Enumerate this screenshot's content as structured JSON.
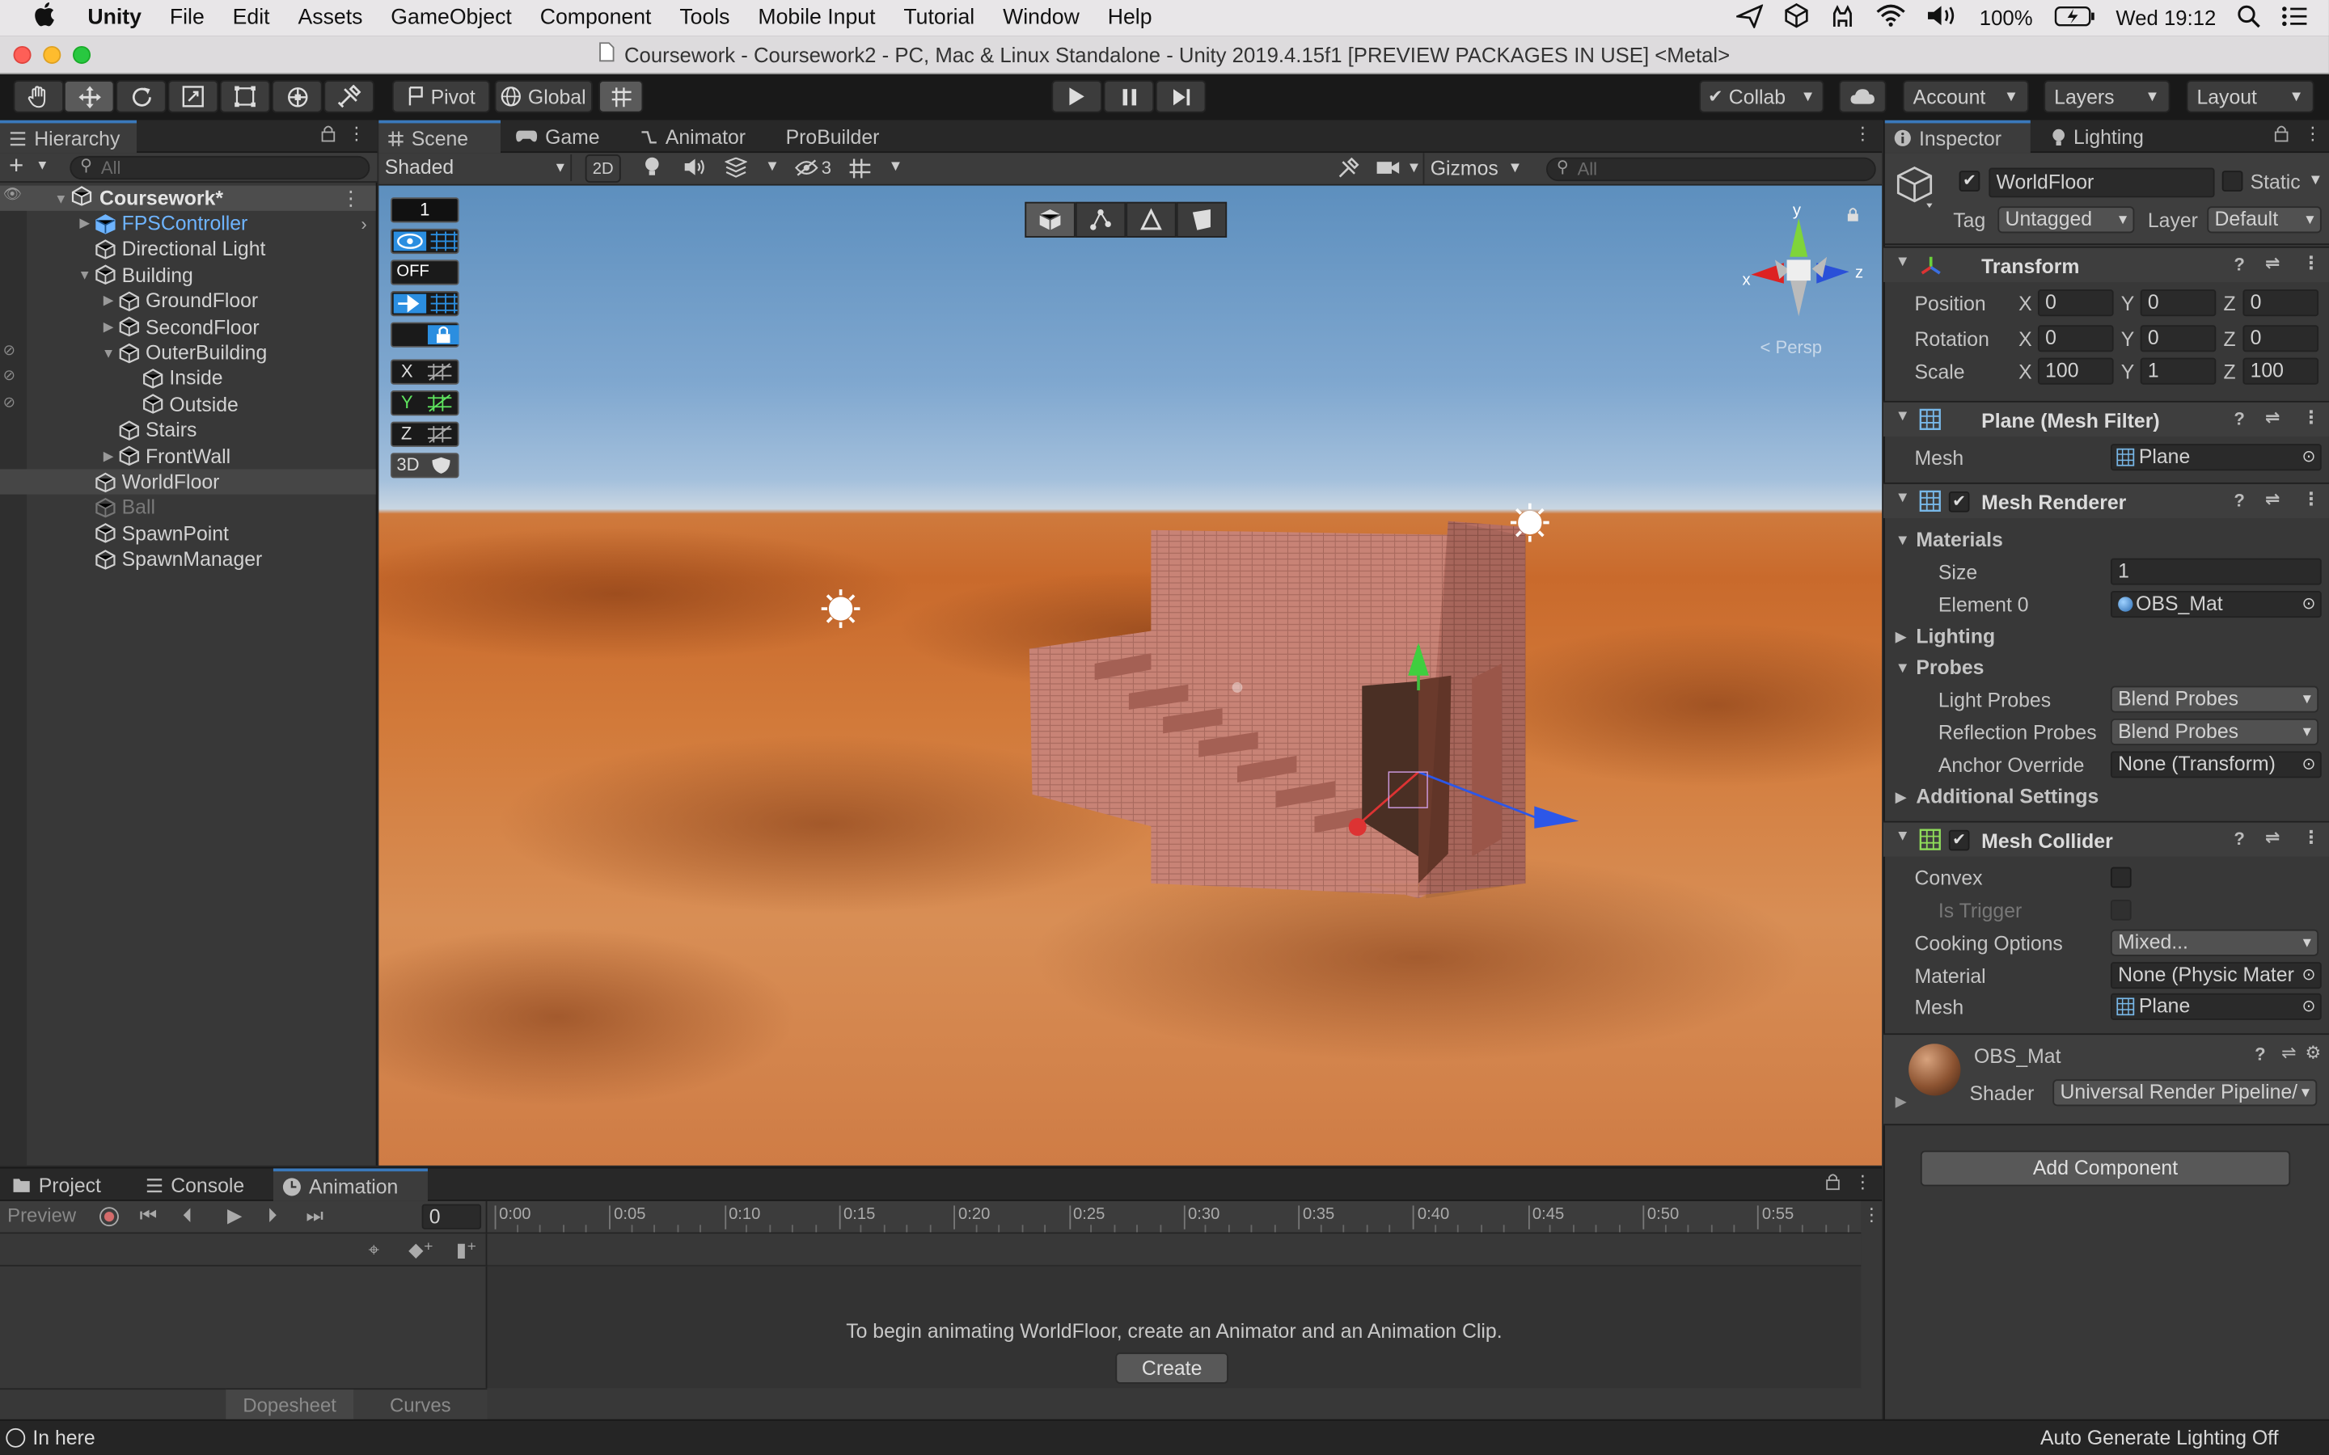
{
  "menubar": {
    "apple": "",
    "app": "Unity",
    "items": [
      "File",
      "Edit",
      "Assets",
      "GameObject",
      "Component",
      "Tools",
      "Mobile Input",
      "Tutorial",
      "Window",
      "Help"
    ],
    "battery": "100%",
    "clock": "Wed 19:12"
  },
  "window": {
    "title": "Coursework - Coursework2 - PC, Mac & Linux Standalone - Unity 2019.4.15f1 [PREVIEW PACKAGES IN USE] <Metal>"
  },
  "toolbar": {
    "pivot": "Pivot",
    "global": "Global",
    "collab": "Collab",
    "account": "Account",
    "layers": "Layers",
    "layout": "Layout"
  },
  "hierarchy": {
    "tab": "Hierarchy",
    "search": "All",
    "scene": "Coursework*",
    "items": [
      {
        "label": "FPSController",
        "depth": 1,
        "arrow": "▶",
        "color": "#6eb4ff"
      },
      {
        "label": "Directional Light",
        "depth": 1,
        "arrow": "",
        "color": "#d2d2d2"
      },
      {
        "label": "Building",
        "depth": 1,
        "arrow": "▼",
        "color": "#d2d2d2"
      },
      {
        "label": "GroundFloor",
        "depth": 2,
        "arrow": "▶",
        "color": "#d2d2d2"
      },
      {
        "label": "SecondFloor",
        "depth": 2,
        "arrow": "▶",
        "color": "#d2d2d2"
      },
      {
        "label": "OuterBuilding",
        "depth": 2,
        "arrow": "▼",
        "color": "#d2d2d2"
      },
      {
        "label": "Inside",
        "depth": 3,
        "arrow": "",
        "color": "#d2d2d2"
      },
      {
        "label": "Outside",
        "depth": 3,
        "arrow": "",
        "color": "#d2d2d2"
      },
      {
        "label": "Stairs",
        "depth": 2,
        "arrow": "",
        "color": "#d2d2d2"
      },
      {
        "label": "FrontWall",
        "depth": 2,
        "arrow": "▶",
        "color": "#d2d2d2"
      },
      {
        "label": "WorldFloor",
        "depth": 1,
        "arrow": "",
        "color": "#d2d2d2"
      },
      {
        "label": "Ball",
        "depth": 1,
        "arrow": "",
        "color": "#7a7a7a"
      },
      {
        "label": "SpawnPoint",
        "depth": 1,
        "arrow": "",
        "color": "#d2d2d2"
      },
      {
        "label": "SpawnManager",
        "depth": 1,
        "arrow": "",
        "color": "#d2d2d2"
      }
    ]
  },
  "scene_tabs": {
    "scene": "Scene",
    "game": "Game",
    "animator": "Animator",
    "probuilder": "ProBuilder"
  },
  "scene_toolbar": {
    "shading": "Shaded",
    "mode2d": "2D",
    "hidden_count": "3",
    "gizmos": "Gizmos",
    "search": "All",
    "persp": "Persp"
  },
  "overlay": {
    "count": "1",
    "off": "OFF",
    "x": "X",
    "y": "Y",
    "z": "Z",
    "d3": "3D"
  },
  "gizmo": {
    "x": "x",
    "y": "y",
    "z": "z"
  },
  "inspector": {
    "tab": "Inspector",
    "lighting_tab": "Lighting",
    "object_name": "WorldFloor",
    "static": "Static",
    "tag_label": "Tag",
    "tag": "Untagged",
    "layer_label": "Layer",
    "layer": "Default",
    "transform": {
      "title": "Transform",
      "position_label": "Position",
      "rotation_label": "Rotation",
      "scale_label": "Scale",
      "x": "X",
      "y": "Y",
      "z": "Z",
      "position": [
        "0",
        "0",
        "0"
      ],
      "rotation": [
        "0",
        "0",
        "0"
      ],
      "scale": [
        "100",
        "1",
        "100"
      ]
    },
    "mesh_filter": {
      "title": "Plane (Mesh Filter)",
      "mesh_label": "Mesh",
      "mesh": "Plane"
    },
    "mesh_renderer": {
      "title": "Mesh Renderer",
      "materials": "Materials",
      "size_label": "Size",
      "size": "1",
      "element0_label": "Element 0",
      "element0": "OBS_Mat",
      "lighting": "Lighting",
      "probes": "Probes",
      "light_probes_label": "Light Probes",
      "light_probes": "Blend Probes",
      "reflection_label": "Reflection Probes",
      "reflection": "Blend Probes",
      "anchor_label": "Anchor Override",
      "anchor": "None (Transform)",
      "additional": "Additional Settings"
    },
    "mesh_collider": {
      "title": "Mesh Collider",
      "convex_label": "Convex",
      "trigger_label": "Is Trigger",
      "cooking_label": "Cooking Options",
      "cooking": "Mixed...",
      "material_label": "Material",
      "material": "None (Physic Mater",
      "mesh_label": "Mesh",
      "mesh": "Plane"
    },
    "material": {
      "name": "OBS_Mat",
      "shader_label": "Shader",
      "shader": "Universal Render Pipeline/"
    },
    "add_component": "Add Component"
  },
  "bottom": {
    "tabs": [
      "Project",
      "Console",
      "Animation"
    ],
    "preview": "Preview",
    "frame": "0",
    "ticks": [
      "0:00",
      "0:05",
      "0:10",
      "0:15",
      "0:20",
      "0:25",
      "0:30",
      "0:35",
      "0:40",
      "0:45",
      "0:50",
      "0:55"
    ],
    "message": "To begin animating WorldFloor, create an Animator and an Animation Clip.",
    "create": "Create",
    "dopesheet": "Dopesheet",
    "curves": "Curves"
  },
  "status": {
    "left": "In here",
    "right": "Auto Generate Lighting Off"
  }
}
